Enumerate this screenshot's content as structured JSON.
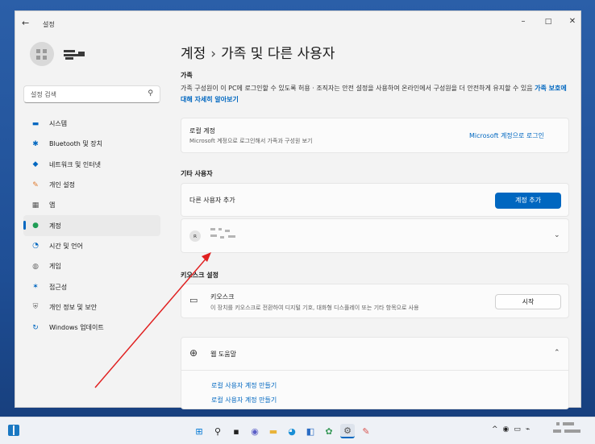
{
  "window": {
    "back_glyph": "←",
    "title": "설정",
    "controls": {
      "minimize": "–",
      "maximize": "□",
      "close": "✕"
    }
  },
  "search": {
    "placeholder": "설정 검색",
    "icon": "search-icon"
  },
  "sidebar": {
    "items": [
      {
        "label": "시스템",
        "icon": "monitor-icon",
        "color": "#0067c0"
      },
      {
        "label": "Bluetooth 및 장치",
        "icon": "bluetooth-icon",
        "color": "#0067c0"
      },
      {
        "label": "네트워크 및 인터넷",
        "icon": "wifi-icon",
        "color": "#0067c0"
      },
      {
        "label": "개인 설정",
        "icon": "brush-icon",
        "color": "#e07a2d"
      },
      {
        "label": "앱",
        "icon": "apps-icon",
        "color": "#555555"
      },
      {
        "label": "계정",
        "icon": "person-icon",
        "color": "#1f9d55",
        "active": true
      },
      {
        "label": "시간 및 언어",
        "icon": "globe-clock-icon",
        "color": "#0067c0"
      },
      {
        "label": "게임",
        "icon": "gamepad-icon",
        "color": "#6b6b6b"
      },
      {
        "label": "접근성",
        "icon": "accessibility-icon",
        "color": "#0067c0"
      },
      {
        "label": "개인 정보 및 보안",
        "icon": "shield-icon",
        "color": "#6b6b6b"
      },
      {
        "label": "Windows 업데이트",
        "icon": "update-icon",
        "color": "#0067c0"
      }
    ]
  },
  "main": {
    "breadcrumb_parent": "계정",
    "breadcrumb_sep": "›",
    "breadcrumb_current": "가족 및 다른 사용자",
    "family": {
      "heading": "가족",
      "desc": "가족 구성원이 이 PC에 로그인할 수 있도록 허용 · 조직자는 안전 설정을 사용하여 온라인에서 구성원을 더 안전하게 유지할 수 있음",
      "link": "가족 보호에 대해 자세히 알아보기"
    },
    "local_account": {
      "title": "로컬 계정",
      "desc": "Microsoft 계정으로 로그인해서 가족과 구성원 보기",
      "action": "Microsoft 계정으로 로그인"
    },
    "other_users": {
      "heading": "기타 사용자",
      "add_label": "다른 사용자 추가",
      "add_button": "계정 추가"
    },
    "kiosk": {
      "heading": "키오스크 설정",
      "title": "키오스크",
      "desc": "이 장치를 키오스크로 전환하여 디지털 기호, 대화형 디스플레이 또는 기타 항목으로 사용",
      "button": "시작"
    },
    "web_help": {
      "title": "웹 도움말",
      "links": [
        "로컬 사용자 계정 만들기",
        "로컬 사용자 계정 만들기"
      ]
    }
  },
  "taskbar": {
    "apps": [
      {
        "glyph": "⊞",
        "name": "start-icon",
        "color": "#0078d4"
      },
      {
        "glyph": "⚲",
        "name": "search-icon",
        "color": "#222222"
      },
      {
        "glyph": "▪",
        "name": "task-view-icon",
        "color": "#222222"
      },
      {
        "glyph": "◉",
        "name": "chat-icon",
        "color": "#5b5fc7"
      },
      {
        "glyph": "▬",
        "name": "file-explorer-icon",
        "color": "#e8b33a"
      },
      {
        "glyph": "◕",
        "name": "edge-icon",
        "color": "#1a8fd6"
      },
      {
        "glyph": "◧",
        "name": "store-icon",
        "color": "#2b6cc4"
      },
      {
        "glyph": "✿",
        "name": "photos-icon",
        "color": "#3a9a5a"
      },
      {
        "glyph": "⚙",
        "name": "settings-icon",
        "color": "#555555",
        "active": true
      },
      {
        "glyph": "✎",
        "name": "paint-icon",
        "color": "#d9544f"
      }
    ],
    "tray": [
      "^",
      "◉",
      "▭",
      "⌁"
    ]
  }
}
